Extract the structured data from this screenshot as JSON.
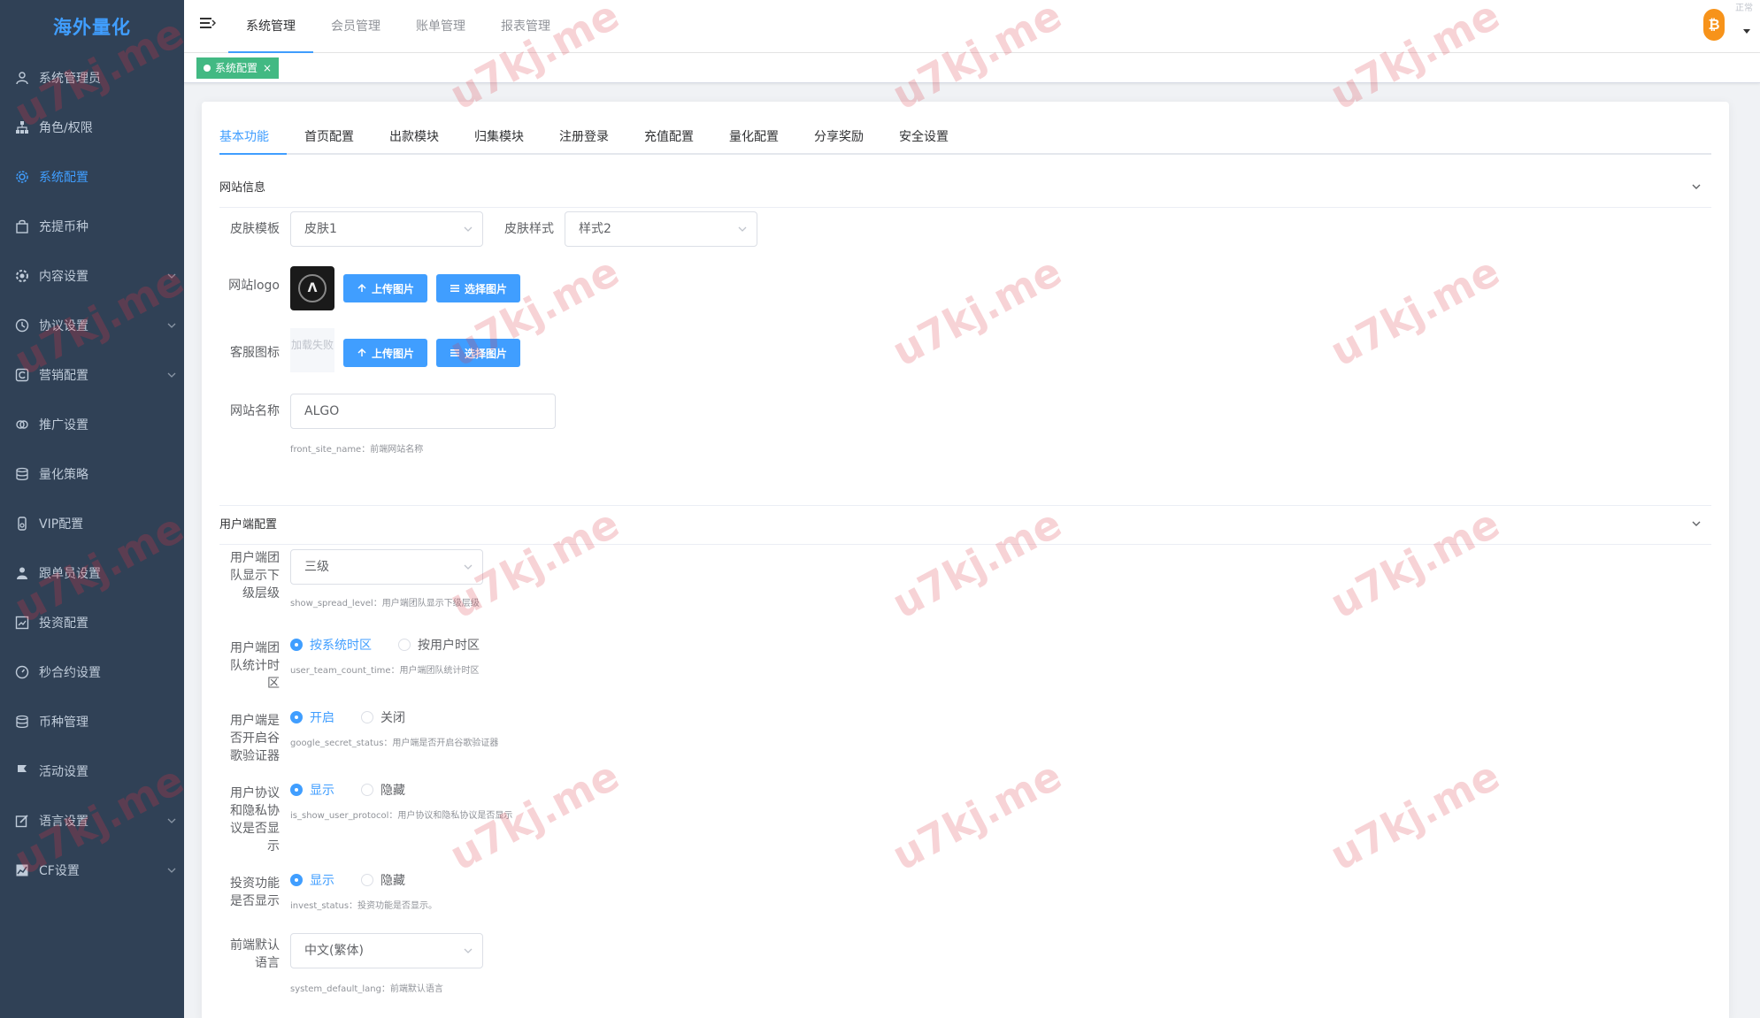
{
  "brand": {
    "name": "海外量化"
  },
  "sidebar": {
    "items": [
      {
        "label": "系统管理员",
        "icon": "user-icon"
      },
      {
        "label": "角色/权限",
        "icon": "org-icon"
      },
      {
        "label": "系统配置",
        "icon": "gear-icon",
        "active": true
      },
      {
        "label": "充提币种",
        "icon": "bag-icon"
      },
      {
        "label": "内容设置",
        "icon": "settings-icon",
        "expandable": true
      },
      {
        "label": "协议设置",
        "icon": "clock-icon",
        "expandable": true
      },
      {
        "label": "营销配置",
        "icon": "copyright-icon",
        "expandable": true
      },
      {
        "label": "推广设置",
        "icon": "link-icon"
      },
      {
        "label": "量化策略",
        "icon": "database-icon"
      },
      {
        "label": "VIP配置",
        "icon": "medal-icon"
      },
      {
        "label": "跟单员设置",
        "icon": "person-icon"
      },
      {
        "label": "投资配置",
        "icon": "picture-icon"
      },
      {
        "label": "秒合约设置",
        "icon": "stopwatch-icon"
      },
      {
        "label": "币种管理",
        "icon": "coins-icon"
      },
      {
        "label": "活动设置",
        "icon": "flag-icon"
      },
      {
        "label": "语言设置",
        "icon": "edit-icon",
        "expandable": true
      },
      {
        "label": "CF设置",
        "icon": "chart-icon",
        "expandable": true
      }
    ]
  },
  "header": {
    "tabs": [
      "系统管理",
      "会员管理",
      "账单管理",
      "报表管理"
    ],
    "active_tab": 0,
    "avatar_symbol": "₿",
    "corner_text": "正常"
  },
  "tags_view": {
    "tag_label": "系统配置",
    "tag_close": "×"
  },
  "config_tabs": [
    "基本功能",
    "首页配置",
    "出款模块",
    "归集模块",
    "注册登录",
    "充值配置",
    "量化配置",
    "分享奖励",
    "安全设置"
  ],
  "section_site": {
    "title": "网站信息",
    "skin_template_label": "皮肤模板",
    "skin_template_value": "皮肤1",
    "skin_style_label": "皮肤样式",
    "skin_style_value": "样式2",
    "logo_label": "网站logo",
    "logo_glyph": "Λ",
    "upload_label": "上传图片",
    "select_label": "选择图片",
    "service_icon_label": "客服图标",
    "service_icon_broken": "加载失败",
    "site_name_label": "网站名称",
    "site_name_value": "ALGO",
    "site_name_hint": "front_site_name：前端网站名称"
  },
  "section_user": {
    "title": "用户端配置",
    "team_level_label": "用户端团队显示下级层级",
    "team_level_value": "三级",
    "team_level_hint": "show_spread_level：用户端团队显示下级层级",
    "count_time_label": "用户端团队统计时区",
    "count_time_opt1": "按系统时区",
    "count_time_opt2": "按用户时区",
    "count_time_hint": "user_team_count_time：用户端团队统计时区",
    "google_label": "用户端是否开启谷歌验证器",
    "google_opt1": "开启",
    "google_opt2": "关闭",
    "google_hint": "google_secret_status：用户端是否开启谷歌验证器",
    "protocol_label": "用户协议和隐私协议是否显示",
    "protocol_opt1": "显示",
    "protocol_opt2": "隐藏",
    "protocol_hint": "is_show_user_protocol：用户协议和隐私协议是否显示",
    "invest_label": "投资功能是否显示",
    "invest_opt1": "显示",
    "invest_opt2": "隐藏",
    "invest_hint": "invest_status：投资功能是否显示。",
    "lang_label": "前端默认语言",
    "lang_value": "中文(繁体)",
    "lang_hint": "system_default_lang：前端默认语言"
  },
  "watermark": "u7kj.me",
  "colors": {
    "sidebar_bg": "#304156",
    "accent": "#409eff",
    "tag_green": "#42b983"
  }
}
